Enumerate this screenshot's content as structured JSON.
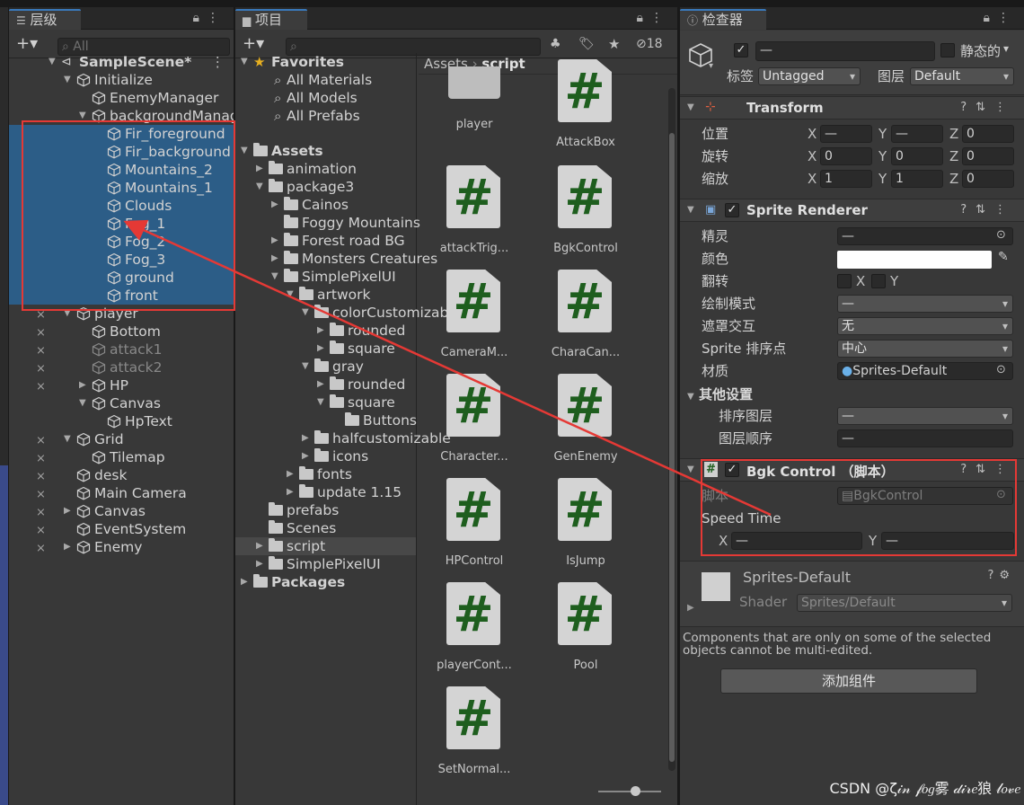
{
  "hierarchy": {
    "tab_label": "层级",
    "search_placeholder": "All",
    "rows": [
      {
        "label": "SampleScene*",
        "indent": 0,
        "type": "scene",
        "expanded": true,
        "selected": false,
        "dim": false
      },
      {
        "label": "Initialize",
        "indent": 1,
        "type": "go",
        "expanded": true,
        "selected": false,
        "dim": false
      },
      {
        "label": "EnemyManager",
        "indent": 2,
        "type": "go",
        "expanded": null,
        "selected": false,
        "dim": false
      },
      {
        "label": "backgroundManager",
        "indent": 2,
        "type": "go",
        "expanded": true,
        "selected": false,
        "dim": false
      },
      {
        "label": "Fir_foreground",
        "indent": 3,
        "type": "go",
        "expanded": null,
        "selected": true,
        "dim": false
      },
      {
        "label": "Fir_background",
        "indent": 3,
        "type": "go",
        "expanded": null,
        "selected": true,
        "dim": false
      },
      {
        "label": "Mountains_2",
        "indent": 3,
        "type": "go",
        "expanded": null,
        "selected": true,
        "dim": false
      },
      {
        "label": "Mountains_1",
        "indent": 3,
        "type": "go",
        "expanded": null,
        "selected": true,
        "dim": false
      },
      {
        "label": "Clouds",
        "indent": 3,
        "type": "go",
        "expanded": null,
        "selected": true,
        "dim": false
      },
      {
        "label": "Fog_1",
        "indent": 3,
        "type": "go",
        "expanded": null,
        "selected": true,
        "dim": false
      },
      {
        "label": "Fog_2",
        "indent": 3,
        "type": "go",
        "expanded": null,
        "selected": true,
        "dim": false
      },
      {
        "label": "Fog_3",
        "indent": 3,
        "type": "go",
        "expanded": null,
        "selected": true,
        "dim": false
      },
      {
        "label": "ground",
        "indent": 3,
        "type": "go",
        "expanded": null,
        "selected": true,
        "dim": false
      },
      {
        "label": "front",
        "indent": 3,
        "type": "go",
        "expanded": null,
        "selected": true,
        "dim": false
      },
      {
        "label": "player",
        "indent": 1,
        "type": "go",
        "expanded": true,
        "selected": false,
        "dim": false,
        "eye": true
      },
      {
        "label": "Bottom",
        "indent": 2,
        "type": "go",
        "expanded": null,
        "selected": false,
        "dim": false,
        "eye": true
      },
      {
        "label": "attack1",
        "indent": 2,
        "type": "go",
        "expanded": null,
        "selected": false,
        "dim": true,
        "eye": true
      },
      {
        "label": "attack2",
        "indent": 2,
        "type": "go",
        "expanded": null,
        "selected": false,
        "dim": true,
        "eye": true
      },
      {
        "label": "HP",
        "indent": 2,
        "type": "go",
        "expanded": false,
        "selected": false,
        "dim": false,
        "eye": true
      },
      {
        "label": "Canvas",
        "indent": 2,
        "type": "go",
        "expanded": true,
        "selected": false,
        "dim": false
      },
      {
        "label": "HpText",
        "indent": 3,
        "type": "go",
        "expanded": null,
        "selected": false,
        "dim": false
      },
      {
        "label": "Grid",
        "indent": 1,
        "type": "go",
        "expanded": true,
        "selected": false,
        "dim": false,
        "eye": true
      },
      {
        "label": "Tilemap",
        "indent": 2,
        "type": "go",
        "expanded": null,
        "selected": false,
        "dim": false,
        "eye": true
      },
      {
        "label": "desk",
        "indent": 1,
        "type": "go",
        "expanded": null,
        "selected": false,
        "dim": false,
        "eye": true
      },
      {
        "label": "Main Camera",
        "indent": 1,
        "type": "go",
        "expanded": null,
        "selected": false,
        "dim": false,
        "eye": true
      },
      {
        "label": "Canvas",
        "indent": 1,
        "type": "go",
        "expanded": false,
        "selected": false,
        "dim": false,
        "eye": true
      },
      {
        "label": "EventSystem",
        "indent": 1,
        "type": "go",
        "expanded": null,
        "selected": false,
        "dim": false,
        "eye": true
      },
      {
        "label": "Enemy",
        "indent": 1,
        "type": "go",
        "expanded": false,
        "selected": false,
        "dim": false,
        "eye": true
      }
    ]
  },
  "project": {
    "tab_label": "项目",
    "hidden_count": "18",
    "breadcrumb": [
      "Assets",
      "script"
    ],
    "tree": [
      {
        "label": "Favorites",
        "indent": 0,
        "kind": "star",
        "expanded": true,
        "bold": true
      },
      {
        "label": "All Materials",
        "indent": 1,
        "kind": "search",
        "expanded": null,
        "bold": false
      },
      {
        "label": "All Models",
        "indent": 1,
        "kind": "search",
        "expanded": null,
        "bold": false
      },
      {
        "label": "All Prefabs",
        "indent": 1,
        "kind": "search",
        "expanded": null,
        "bold": false
      },
      {
        "label": "",
        "indent": 0,
        "kind": "spacer",
        "expanded": null,
        "bold": false
      },
      {
        "label": "Assets",
        "indent": 0,
        "kind": "folder",
        "expanded": true,
        "bold": true
      },
      {
        "label": "animation",
        "indent": 1,
        "kind": "folder",
        "expanded": false,
        "bold": false
      },
      {
        "label": "package3",
        "indent": 1,
        "kind": "folder",
        "expanded": true,
        "bold": false
      },
      {
        "label": "Cainos",
        "indent": 2,
        "kind": "folder",
        "expanded": false,
        "bold": false
      },
      {
        "label": "Foggy Mountains",
        "indent": 2,
        "kind": "folder",
        "expanded": null,
        "bold": false
      },
      {
        "label": "Forest road BG",
        "indent": 2,
        "kind": "folder",
        "expanded": false,
        "bold": false
      },
      {
        "label": "Monsters Creatures",
        "indent": 2,
        "kind": "folder",
        "expanded": false,
        "bold": false
      },
      {
        "label": "SimplePixelUI",
        "indent": 2,
        "kind": "folder",
        "expanded": true,
        "bold": false
      },
      {
        "label": "artwork",
        "indent": 3,
        "kind": "folder",
        "expanded": true,
        "bold": false
      },
      {
        "label": "colorCustomizable",
        "indent": 4,
        "kind": "folder",
        "expanded": true,
        "bold": false
      },
      {
        "label": "rounded",
        "indent": 5,
        "kind": "folder",
        "expanded": false,
        "bold": false
      },
      {
        "label": "square",
        "indent": 5,
        "kind": "folder",
        "expanded": false,
        "bold": false
      },
      {
        "label": "gray",
        "indent": 4,
        "kind": "folder",
        "expanded": true,
        "bold": false
      },
      {
        "label": "rounded",
        "indent": 5,
        "kind": "folder",
        "expanded": false,
        "bold": false
      },
      {
        "label": "square",
        "indent": 5,
        "kind": "folder",
        "expanded": true,
        "bold": false
      },
      {
        "label": "Buttons",
        "indent": 6,
        "kind": "folder",
        "expanded": null,
        "bold": false
      },
      {
        "label": "halfcustomizable",
        "indent": 4,
        "kind": "folder",
        "expanded": false,
        "bold": false
      },
      {
        "label": "icons",
        "indent": 4,
        "kind": "folder",
        "expanded": false,
        "bold": false
      },
      {
        "label": "fonts",
        "indent": 3,
        "kind": "folder",
        "expanded": false,
        "bold": false
      },
      {
        "label": "update 1.15",
        "indent": 3,
        "kind": "folder",
        "expanded": false,
        "bold": false
      },
      {
        "label": "prefabs",
        "indent": 1,
        "kind": "folder",
        "expanded": null,
        "bold": false
      },
      {
        "label": "Scenes",
        "indent": 1,
        "kind": "folder",
        "expanded": null,
        "bold": false
      },
      {
        "label": "script",
        "indent": 1,
        "kind": "folder",
        "expanded": false,
        "bold": false,
        "selected": true
      },
      {
        "label": "SimplePixelUI",
        "indent": 1,
        "kind": "folder",
        "expanded": false,
        "bold": false
      },
      {
        "label": "Packages",
        "indent": 0,
        "kind": "folder",
        "expanded": false,
        "bold": true
      }
    ],
    "assets": [
      {
        "label": "player",
        "kind": "prefab"
      },
      {
        "label": "AttackBox",
        "kind": "script"
      },
      {
        "label": "attackTrig...",
        "kind": "script"
      },
      {
        "label": "BgkControl",
        "kind": "script"
      },
      {
        "label": "CameraM...",
        "kind": "script"
      },
      {
        "label": "CharaCan...",
        "kind": "script"
      },
      {
        "label": "Character...",
        "kind": "script"
      },
      {
        "label": "GenEnemy",
        "kind": "script"
      },
      {
        "label": "HPControl",
        "kind": "script"
      },
      {
        "label": "IsJump",
        "kind": "script"
      },
      {
        "label": "playerCont...",
        "kind": "script"
      },
      {
        "label": "Pool",
        "kind": "script"
      },
      {
        "label": "SetNormal...",
        "kind": "script"
      }
    ]
  },
  "inspector": {
    "tab_label": "检查器",
    "name_value": "—",
    "static_label": "静态的",
    "tag_label": "标签",
    "tag_value": "Untagged",
    "layer_label": "图层",
    "layer_value": "Default",
    "transform": {
      "title": "Transform",
      "rows": [
        {
          "label": "位置",
          "x": "—",
          "y": "—",
          "z": "0"
        },
        {
          "label": "旋转",
          "x": "0",
          "y": "0",
          "z": "0"
        },
        {
          "label": "缩放",
          "x": "1",
          "y": "1",
          "z": "0"
        }
      ]
    },
    "sprite_renderer": {
      "title": "Sprite Renderer",
      "sprite_label": "精灵",
      "sprite_value": "—",
      "color_label": "颜色",
      "flip_label": "翻转",
      "flip_x": "X",
      "flip_y": "Y",
      "draw_mode_label": "绘制模式",
      "draw_mode_value": "—",
      "mask_label": "遮罩交互",
      "mask_value": "无",
      "sort_point_label": "Sprite 排序点",
      "sort_point_value": "中心",
      "material_label": "材质",
      "material_value": "Sprites-Default",
      "other_label": "其他设置",
      "sort_layer_label": "排序图层",
      "sort_layer_value": "—",
      "order_label": "图层顺序",
      "order_value": "—"
    },
    "bgk": {
      "title": "Bgk Control （脚本）",
      "script_label": "脚本",
      "script_value": "BgkControl",
      "speed_label": "Speed Time",
      "x_label": "X",
      "x_value": "—",
      "y_label": "Y",
      "y_value": "—"
    },
    "material": {
      "name": "Sprites-Default",
      "shader_label": "Shader",
      "shader_value": "Sprites/Default"
    },
    "note": "Components that are only on some of the selected objects cannot be multi-edited.",
    "add_component": "添加组件"
  },
  "watermark": "CSDN @ζ𝒾𝓃 𝒻𝑜𝑔雾 𝒹𝒾𝓇𝑒狼 𝓁𝑜𝓋𝑒",
  "colors": {
    "selection": "#2c5d87",
    "highlight_box": "#e53935",
    "script_hash": "#1e5e1e",
    "panel_bg": "#383838"
  }
}
